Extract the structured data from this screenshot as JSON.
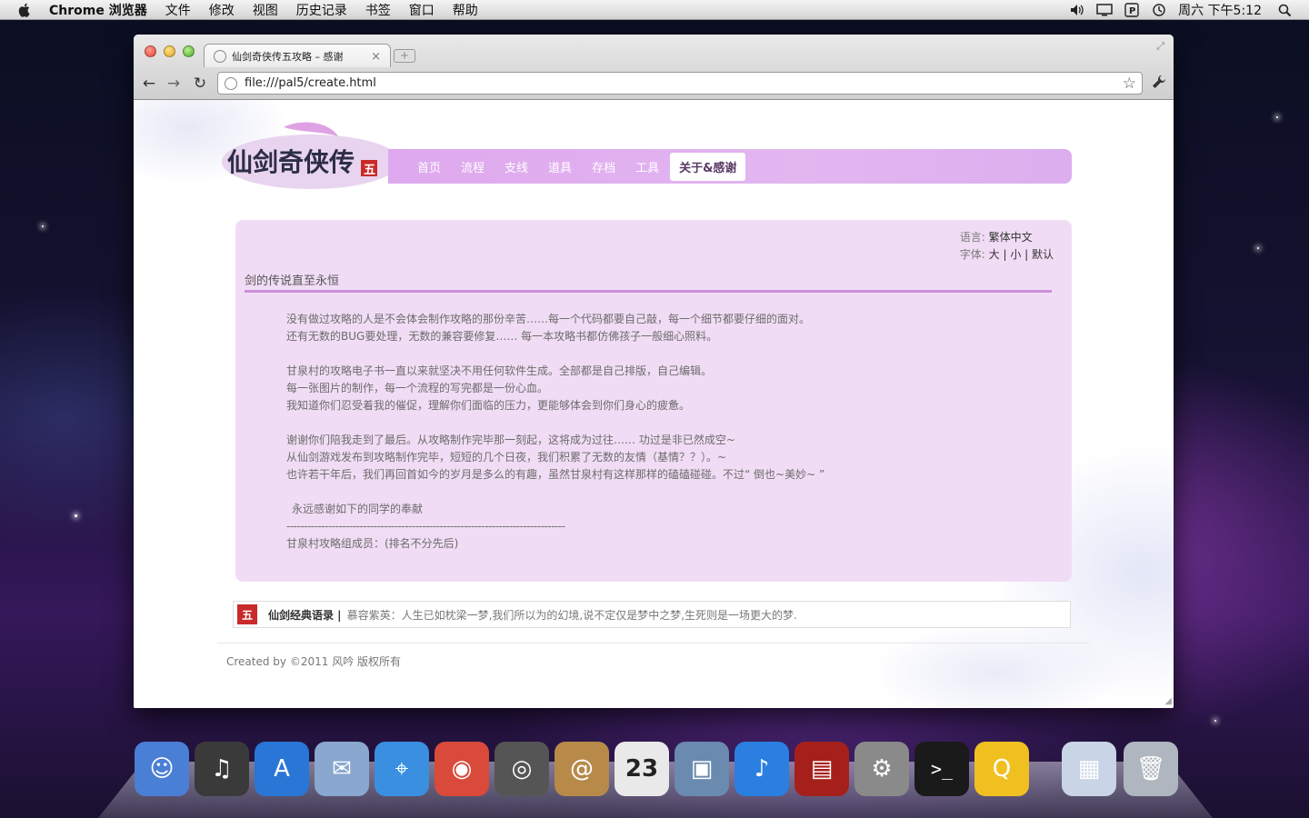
{
  "menubar": {
    "app_name": "Chrome 浏览器",
    "items": [
      "文件",
      "修改",
      "视图",
      "历史记录",
      "书签",
      "窗口",
      "帮助"
    ],
    "clock": "周六 下午5:12"
  },
  "browser": {
    "tab_title": "仙剑奇侠传五攻略 – 感谢",
    "url": "file:///pal5/create.html"
  },
  "site": {
    "nav": [
      "首页",
      "流程",
      "支线",
      "道具",
      "存档",
      "工具"
    ],
    "nav_active": "关于&感谢",
    "language_label": "语言:",
    "language_value": "繁体中文",
    "font_label": "字体:",
    "font_options": "大 | 小 | 默认",
    "section_title": "剑的传说直至永恒",
    "paragraphs": [
      [
        "没有做过攻略的人是不会体会制作攻略的那份辛苦……每一个代码都要自己敲，每一个细节都要仔细的面对。",
        "还有无数的BUG要处理，无数的兼容要修复…… 每一本攻略书都仿佛孩子一般细心照料。"
      ],
      [
        "甘泉村的攻略电子书一直以来就坚决不用任何软件生成。全部都是自己排版，自己编辑。",
        "每一张图片的制作，每一个流程的写完都是一份心血。",
        "我知道你们忍受着我的催促，理解你们面临的压力，更能够体会到你们身心的疲惫。"
      ],
      [
        "谢谢你们陪我走到了最后。从攻略制作完毕那一刻起，这将成为过往…… 功过是非已然成空~",
        "从仙剑游戏发布到攻略制作完毕，短短的几个日夜，我们积累了无数的友情（基情？？）。~",
        "也许若干年后，我们再回首如今的岁月是多么的有趣，虽然甘泉村有这样那样的磕磕碰碰。不过“ 倒也~美妙~ ”"
      ]
    ],
    "thanks_line": "永远感谢如下的同学的奉献",
    "dashes": "--------------------------------------------------------------------------------",
    "members_line": "甘泉村攻略组成员：(排名不分先后)",
    "quote_label": "仙剑经典语录 |",
    "quote_text": "慕容紫英：人生已如枕梁一梦,我们所以为的幻境,说不定仅是梦中之梦,生死则是一场更大的梦.",
    "footer": "Created by ©2011 风吟 版权所有",
    "logo_text": "仙剑奇侠传",
    "logo_badge": "五"
  },
  "dock": {
    "items": [
      {
        "name": "finder",
        "color": "#4a7fd6",
        "glyph": "☺"
      },
      {
        "name": "dashboard",
        "color": "#3a3a3a",
        "glyph": "♫"
      },
      {
        "name": "app-store",
        "color": "#2a76d6",
        "glyph": "A"
      },
      {
        "name": "mail",
        "color": "#8aa7cf",
        "glyph": "✉"
      },
      {
        "name": "safari",
        "color": "#3a8fe0",
        "glyph": "⌖"
      },
      {
        "name": "chrome",
        "color": "#d94a3a",
        "glyph": "◉"
      },
      {
        "name": "facetime",
        "color": "#555555",
        "glyph": "◎"
      },
      {
        "name": "address-book",
        "color": "#b78a4a",
        "glyph": "@"
      },
      {
        "name": "calendar",
        "color": "#e9e9e9",
        "glyph": "23"
      },
      {
        "name": "iphoto",
        "color": "#6a8ab0",
        "glyph": "▣"
      },
      {
        "name": "itunes",
        "color": "#2a7fe0",
        "glyph": "♪"
      },
      {
        "name": "photo-booth",
        "color": "#a5201a",
        "glyph": "▤"
      },
      {
        "name": "system-preferences",
        "color": "#8a8a8a",
        "glyph": "⚙"
      },
      {
        "name": "terminal",
        "color": "#1a1a1a",
        "glyph": ">_"
      },
      {
        "name": "qq",
        "color": "#f0c020",
        "glyph": "Q"
      },
      {
        "name": "documents",
        "color": "#c9d4e6",
        "glyph": "▦"
      },
      {
        "name": "trash",
        "color": "#b0b6c0",
        "glyph": "🗑"
      }
    ]
  }
}
